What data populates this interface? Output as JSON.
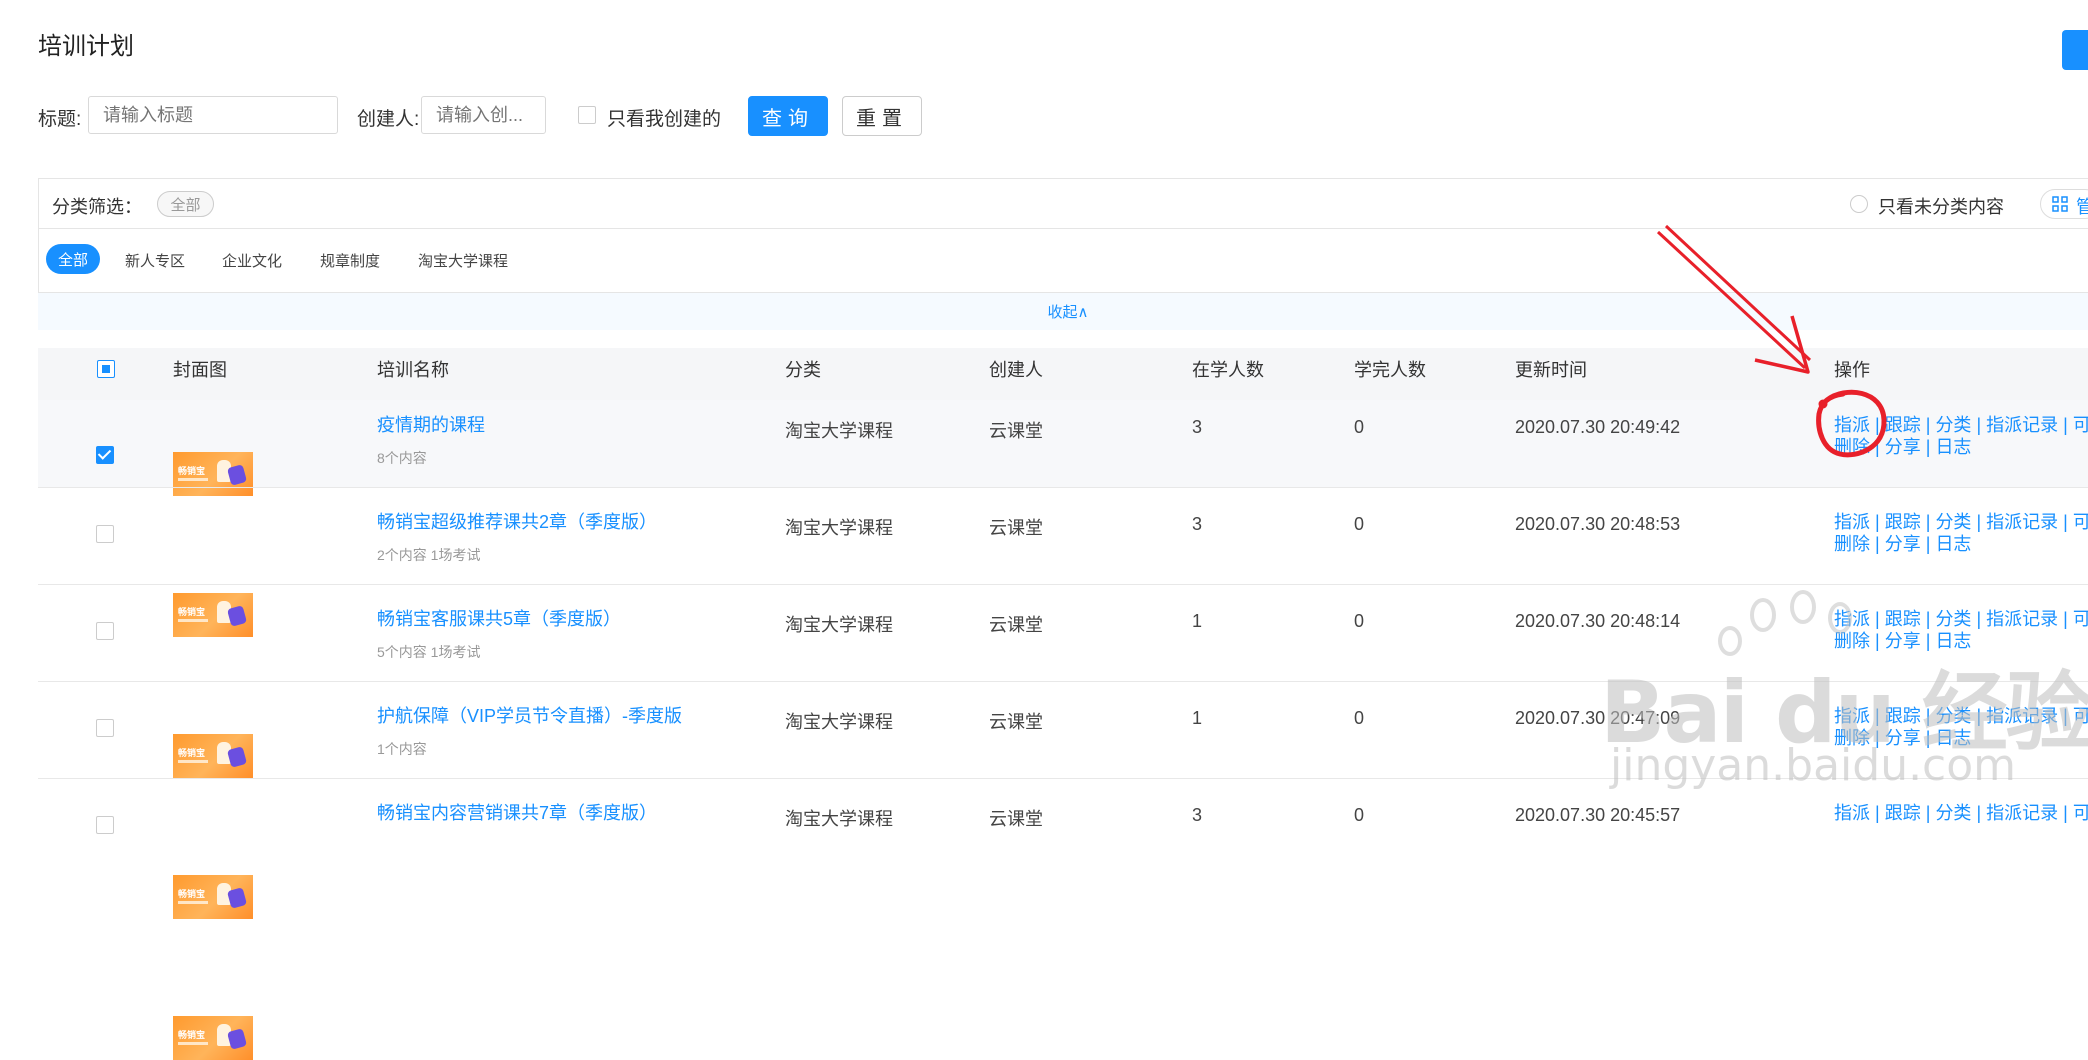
{
  "page": {
    "title": "培训计划"
  },
  "search": {
    "title_label": "标题:",
    "title_placeholder": "请输入标题",
    "creator_label": "创建人:",
    "creator_placeholder": "请输入创...",
    "only_mine_label": "只看我创建的",
    "query_button": "查询",
    "reset_button": "重置"
  },
  "category": {
    "filter_label": "分类筛选：",
    "current_tag": "全部",
    "only_uncategorized_label": "只看未分类内容",
    "manage_label": "管",
    "items": [
      "全部",
      "新人专区",
      "企业文化",
      "规章制度",
      "淘宝大学课程"
    ],
    "collapse_label": "收起∧"
  },
  "table": {
    "headers": {
      "cover": "封面图",
      "name": "培训名称",
      "category": "分类",
      "creator": "创建人",
      "learning": "在学人数",
      "finished": "学完人数",
      "updated": "更新时间",
      "actions": "操作"
    },
    "actions_line1": [
      "指派",
      "跟踪",
      "分类",
      "指派记录",
      "可"
    ],
    "actions_line2": [
      "删除",
      "分享",
      "日志"
    ],
    "separator": "|",
    "thumb_text": "畅销宝",
    "rows": [
      {
        "name": "疫情期的课程",
        "sub": "8个内容",
        "category": "淘宝大学课程",
        "creator": "云课堂",
        "learning": "3",
        "finished": "0",
        "updated": "2020.07.30 20:49:42",
        "checked": true
      },
      {
        "name": "畅销宝超级推荐课共2章（季度版）",
        "sub": "2个内容 1场考试",
        "category": "淘宝大学课程",
        "creator": "云课堂",
        "learning": "3",
        "finished": "0",
        "updated": "2020.07.30 20:48:53",
        "checked": false
      },
      {
        "name": "畅销宝客服课共5章（季度版）",
        "sub": "5个内容 1场考试",
        "category": "淘宝大学课程",
        "creator": "云课堂",
        "learning": "1",
        "finished": "0",
        "updated": "2020.07.30 20:48:14",
        "checked": false
      },
      {
        "name": "护航保障（VIP学员节令直播）-季度版",
        "sub": "1个内容",
        "category": "淘宝大学课程",
        "creator": "云课堂",
        "learning": "1",
        "finished": "0",
        "updated": "2020.07.30 20:47:09",
        "checked": false
      },
      {
        "name": "畅销宝内容营销课共7章（季度版）",
        "sub": "",
        "category": "淘宝大学课程",
        "creator": "云课堂",
        "learning": "3",
        "finished": "0",
        "updated": "2020.07.30 20:45:57",
        "checked": false
      }
    ]
  },
  "watermark": {
    "brand": "Bai du 经验",
    "url": "jingyan.baidu.com"
  },
  "colors": {
    "accent": "#1890ff",
    "annotation": "#e8202a"
  }
}
